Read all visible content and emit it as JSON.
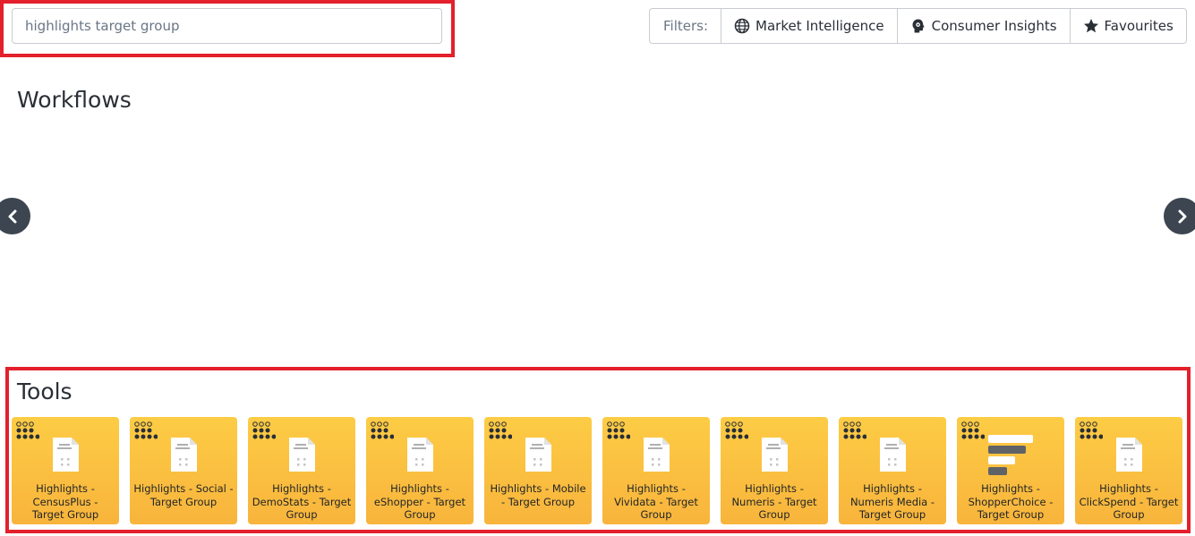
{
  "search": {
    "value": "highlights target group",
    "placeholder": "highlights target group"
  },
  "filters": {
    "label": "Filters:",
    "items": [
      {
        "label": "Market Intelligence",
        "icon": "globe-icon"
      },
      {
        "label": "Consumer Insights",
        "icon": "head-icon"
      },
      {
        "label": "Favourites",
        "icon": "star-icon"
      }
    ]
  },
  "workflows": {
    "title": "Workflows"
  },
  "tools": {
    "title": "Tools",
    "items": [
      {
        "label": "Highlights - CensusPlus - Target Group",
        "icon": "document-icon"
      },
      {
        "label": "Highlights - Social - Target Group",
        "icon": "document-icon"
      },
      {
        "label": "Highlights - DemoStats - Target Group",
        "icon": "document-icon"
      },
      {
        "label": "Highlights - eShopper - Target Group",
        "icon": "document-icon"
      },
      {
        "label": "Highlights - Mobile - Target Group",
        "icon": "document-icon"
      },
      {
        "label": "Highlights - Vividata - Target Group",
        "icon": "document-icon"
      },
      {
        "label": "Highlights - Numeris - Target Group",
        "icon": "document-icon"
      },
      {
        "label": "Highlights - Numeris Media - Target Group",
        "icon": "document-icon"
      },
      {
        "label": "Highlights - ShopperChoice - Target Group",
        "icon": "bars-icon"
      },
      {
        "label": "Highlights - ClickSpend - Target Group",
        "icon": "document-icon"
      }
    ]
  },
  "colors": {
    "accent": "#e3202c",
    "tile_top": "#fdcc45",
    "tile_bottom": "#f8b43c",
    "nav": "#3c4550"
  }
}
